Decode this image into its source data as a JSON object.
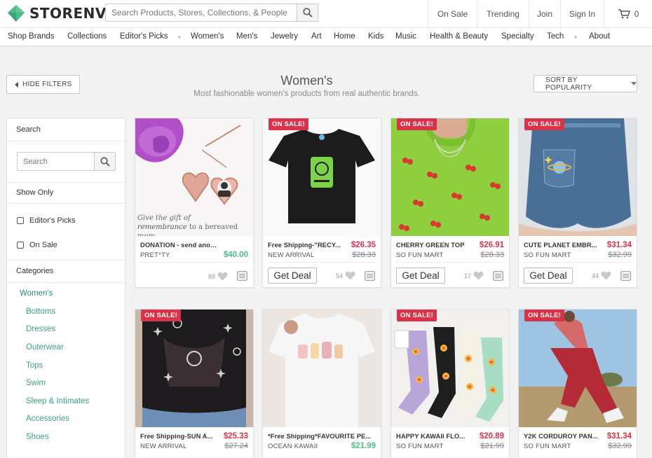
{
  "brand": {
    "name": "STORENVY",
    "accent": "#4cbb87",
    "sale_color": "#d9334a"
  },
  "search": {
    "placeholder": "Search Products, Stores, Collections, & People"
  },
  "topnav": {
    "on_sale": "On Sale",
    "trending": "Trending",
    "join": "Join",
    "sign_in": "Sign In",
    "cart_count": "0"
  },
  "catnav": [
    "Shop Brands",
    "Collections",
    "Editor's Picks",
    "Women's",
    "Men's",
    "Jewelry",
    "Art",
    "Home",
    "Kids",
    "Music",
    "Health & Beauty",
    "Specialty",
    "Tech",
    "About"
  ],
  "page": {
    "title": "Women's",
    "subtitle": "Most fashionable women's products from real authentic brands.",
    "hide_filters": "HIDE FILTERS",
    "sort": "SORT BY POPULARITY"
  },
  "sidebar": {
    "search_heading": "Search",
    "search_placeholder": "Search",
    "show_only_heading": "Show Only",
    "checkbox_editors": "Editor's Picks",
    "checkbox_sale": "On Sale",
    "categories_heading": "Categories",
    "category": "Women's",
    "subcategories": [
      "Bottoms",
      "Dresses",
      "Outerwear",
      "Tops",
      "Swim",
      "Sleep & Intimates",
      "Accessories",
      "Shoes"
    ]
  },
  "products": [
    {
      "badge": "",
      "name": "DONATION - send anonymous ...",
      "shop": "PRET*TY",
      "price": "$40.00",
      "original": "",
      "action": "",
      "likes": "89",
      "image": "heart-locket-flowers",
      "image_caption_1": "Give the gift of",
      "image_caption_2": "remembrance",
      "image_caption_3": "to a bereaved mom"
    },
    {
      "badge": "ON SALE!",
      "name": "Free Shipping-\"RECY...",
      "shop": "NEW ARRIVAL",
      "price": "$26.35",
      "original": "$28.33",
      "action": "Get Deal",
      "likes": "54",
      "image": "black-tshirt-recycle-print"
    },
    {
      "badge": "ON SALE!",
      "name": "CHERRY GREEN TOP",
      "shop": "SO FUN MART",
      "price": "$26.91",
      "original": "$28.33",
      "action": "Get Deal",
      "likes": "17",
      "image": "green-cherry-knit-top"
    },
    {
      "badge": "ON SALE!",
      "name": "CUTE PLANET EMBR...",
      "shop": "SO FUN MART",
      "price": "$31.34",
      "original": "$32.99",
      "action": "Get Deal",
      "likes": "44",
      "image": "denim-shorts-planet-embroidery"
    },
    {
      "badge": "ON SALE!",
      "name": "Free Shipping-SUN A...",
      "shop": "NEW ARRIVAL",
      "price": "$25.33",
      "original": "$27.24",
      "action": "",
      "likes": "",
      "image": "mesh-sun-moon-top"
    },
    {
      "badge": "",
      "name": "*Free Shipping*FAVOURITE PE...",
      "shop": "OCEAN KAWAII",
      "price": "$21.99",
      "original": "",
      "action": "",
      "likes": "",
      "image": "white-tshirt-kawaii-print"
    },
    {
      "badge": "ON SALE!",
      "name": "HAPPY KAWAII FLO...",
      "shop": "SO FUN MART",
      "price": "$20.89",
      "original": "$21.99",
      "action": "",
      "likes": "",
      "image": "kawaii-flower-socks"
    },
    {
      "badge": "ON SALE!",
      "name": "Y2K CORDUROY PAN...",
      "shop": "SO FUN MART",
      "price": "$31.34",
      "original": "$32.99",
      "action": "",
      "likes": "",
      "image": "red-corduroy-pants"
    }
  ]
}
